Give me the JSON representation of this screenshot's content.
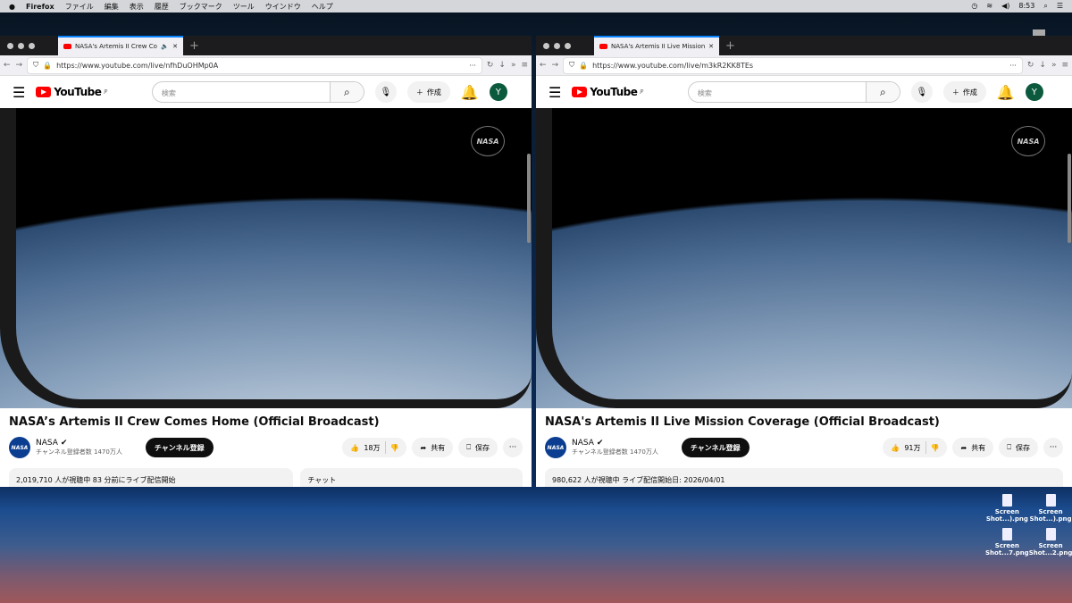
{
  "menubar": {
    "app": "Firefox",
    "items": [
      "ファイル",
      "編集",
      "表示",
      "履歴",
      "ブックマーク",
      "ツール",
      "ウインドウ",
      "ヘルプ"
    ],
    "time": "8:53"
  },
  "windows": [
    {
      "tab_title": "NASA's Artemis II Crew Com",
      "url": "https://www.youtube.com/live/nfhDuOHMp0A",
      "search_placeholder": "検索",
      "create": "作成",
      "avatar": "Y",
      "logo": "YouTube",
      "region": "JP",
      "video_watermark": "NASA",
      "video_title": "NASA’s Artemis II Crew Comes Home (Official Broadcast)",
      "channel": "NASA",
      "subscribers": "チャンネル登録者数 1470万人",
      "subscribe": "チャンネル登録",
      "likes": "18万",
      "share": "共有",
      "save": "保存",
      "stats": "2,019,710 人が視聴中  83 分前にライブ配信開始",
      "chat": "チャット"
    },
    {
      "tab_title": "NASA's Artemis II Live Mission",
      "url": "https://www.youtube.com/live/m3kR2KK8TEs",
      "search_placeholder": "検索",
      "create": "作成",
      "avatar": "Y",
      "logo": "YouTube",
      "region": "JP",
      "video_watermark": "NASA",
      "video_title": "NASA's Artemis II Live Mission Coverage (Official Broadcast)",
      "channel": "NASA",
      "subscribers": "チャンネル登録者数 1470万人",
      "subscribe": "チャンネル登録",
      "likes": "91万",
      "share": "共有",
      "save": "保存",
      "stats": "980,622 人が視聴中  ライブ配信開始日: 2026/04/01"
    }
  ],
  "desktop_icons": [
    {
      "l1": "Screen",
      "l2": "Shot...).png"
    },
    {
      "l1": "Screen",
      "l2": "Shot...).png"
    },
    {
      "l1": "Screen",
      "l2": "Shot...7.png"
    },
    {
      "l1": "Screen",
      "l2": "Shot...2.png"
    }
  ]
}
